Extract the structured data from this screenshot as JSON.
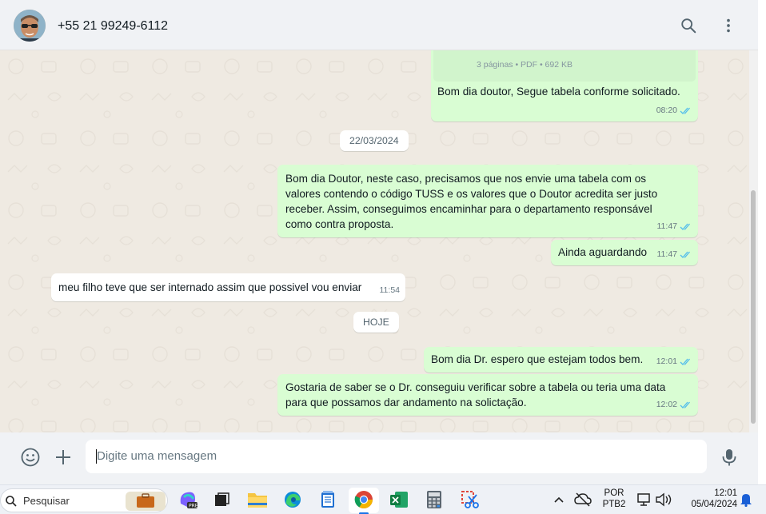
{
  "header": {
    "contact_name": "+55 21 99249-6112",
    "search_icon": "search-icon",
    "menu_icon": "more-vertical-icon"
  },
  "messages": {
    "pdf_meta": "3 páginas • PDF • 692 KB",
    "m1": {
      "text": "Bom dia doutor, Segue tabela conforme solicitado.",
      "time": "08:20"
    },
    "date_chip_1": "22/03/2024",
    "m2": {
      "text": "Bom dia Doutor, neste caso, precisamos que nos envie uma tabela com os valores contendo o código TUSS e os valores que o Doutor acredita ser justo receber. Assim, conseguimos encaminhar para o departamento responsável como contra proposta.",
      "time": "11:47"
    },
    "m3": {
      "text": "Ainda aguardando",
      "time": "11:47"
    },
    "m4": {
      "text": "meu filho teve que ser internado assim que possivel vou enviar",
      "time": "11:54"
    },
    "date_chip_2": "HOJE",
    "m5": {
      "text": "Bom dia Dr. espero que estejam todos bem.",
      "time": "12:01"
    },
    "m6": {
      "text": "Gostaria de saber se o Dr. conseguiu verificar sobre a tabela ou teria uma data para que possamos dar andamento na solictação.",
      "time": "12:02"
    }
  },
  "composer": {
    "placeholder": "Digite uma mensagem",
    "emoji_icon": "emoji-icon",
    "attach_icon": "plus-icon",
    "mic_icon": "microphone-icon"
  },
  "taskbar": {
    "search_label": "Pesquisar",
    "lang_top": "POR",
    "lang_bottom": "PTB2",
    "time": "12:01",
    "date": "05/04/2024"
  },
  "colors": {
    "outgoing_bubble": "#d9fdd3",
    "incoming_bubble": "#ffffff",
    "chat_background": "#efeae2",
    "read_ticks": "#53bdeb"
  }
}
